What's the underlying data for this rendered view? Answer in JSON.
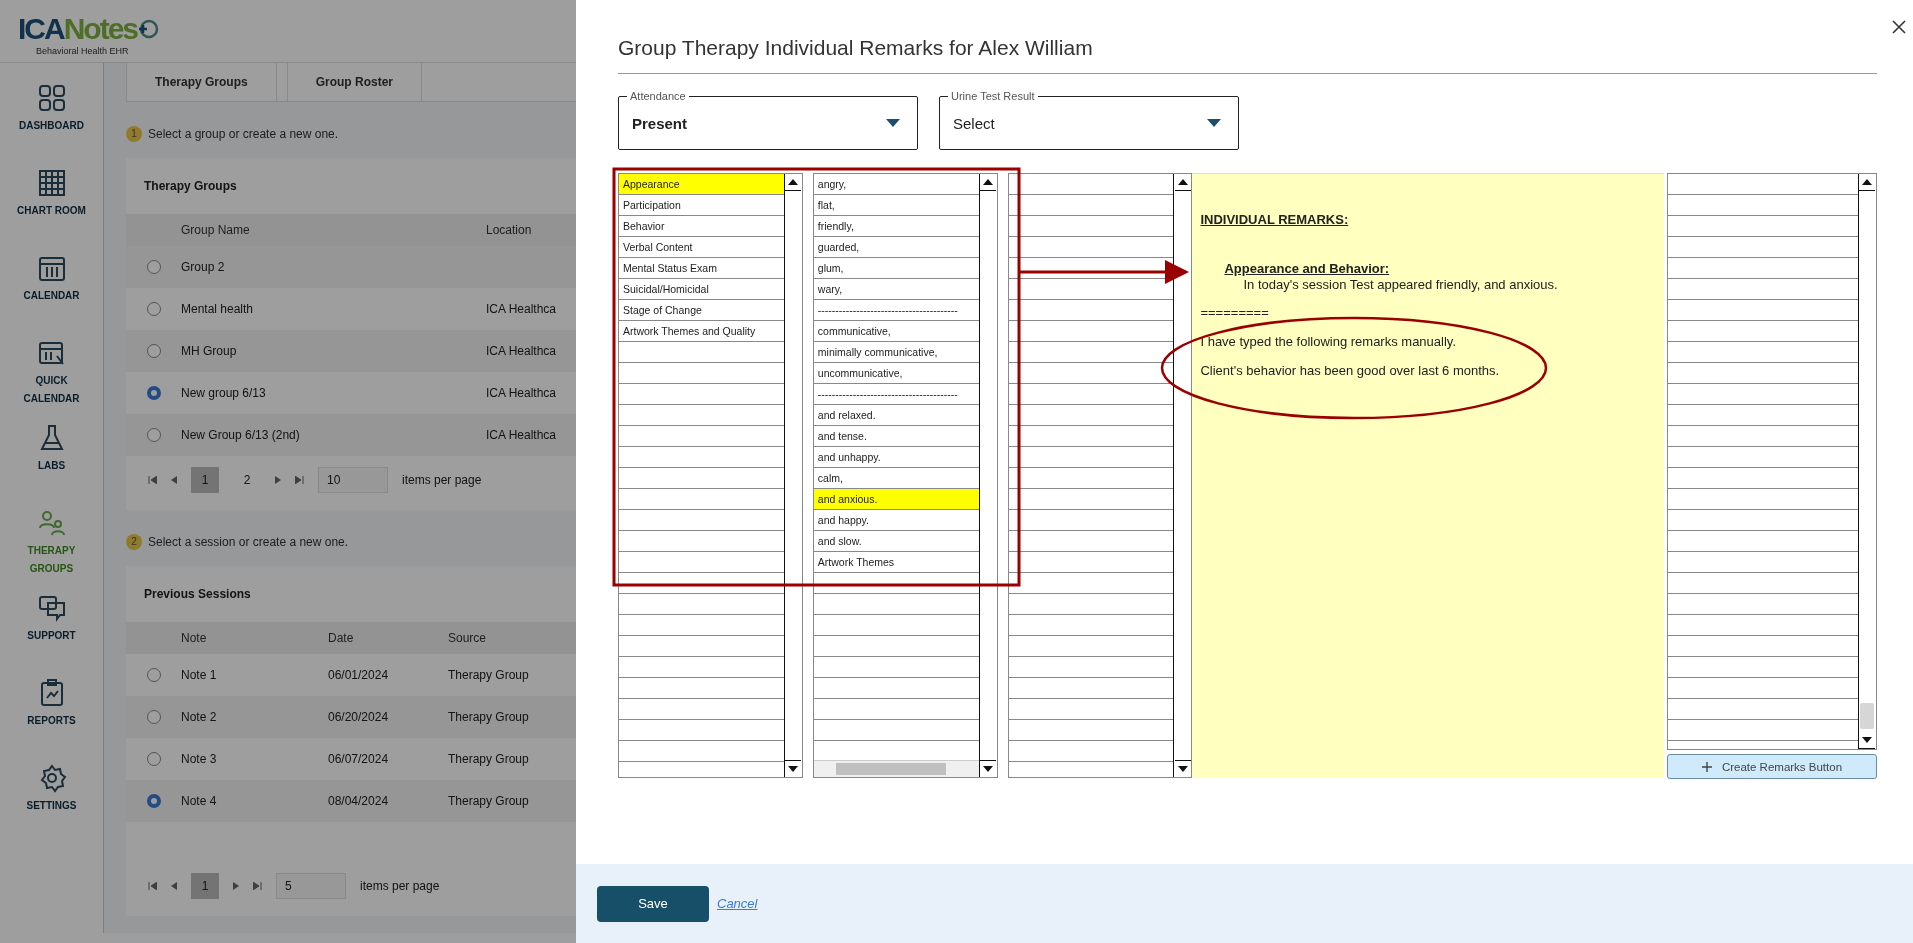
{
  "app": {
    "logo": {
      "prefix": "ICA",
      "suffix": "Notes",
      "tagline": "Behavioral Health EHR"
    },
    "nav": [
      {
        "label": "DASHBOARD",
        "selected": false
      },
      {
        "label": "CHART ROOM",
        "selected": false
      },
      {
        "label": "CALENDAR",
        "selected": false
      },
      {
        "label": "QUICK CALENDAR",
        "selected": false
      },
      {
        "label": "LABS",
        "selected": false
      },
      {
        "label": "THERAPY GROUPS",
        "selected": true
      },
      {
        "label": "SUPPORT",
        "selected": false
      },
      {
        "label": "REPORTS",
        "selected": false
      },
      {
        "label": "SETTINGS",
        "selected": false
      }
    ],
    "tabs": [
      {
        "label": "Therapy Groups"
      },
      {
        "label": "Group Roster"
      }
    ],
    "step1": {
      "number": "1",
      "text": "Select a group or create a new one."
    },
    "groups": {
      "title": "Therapy Groups",
      "columns": [
        "Group Name",
        "Location"
      ],
      "rows": [
        {
          "name": "Group 2",
          "selected": false
        },
        {
          "name": "Mental health",
          "location": "ICA Healthca",
          "selected": false
        },
        {
          "name": "MH Group",
          "location": "ICA Healthca",
          "selected": false
        },
        {
          "name": "New group 6/13",
          "location": "ICA Healthca",
          "selected": true
        },
        {
          "name": "New Group 6/13 (2nd)",
          "location": "ICA Healthca",
          "selected": false
        }
      ],
      "pager": {
        "pages": [
          {
            "label": "1",
            "selected": true
          },
          {
            "label": "2",
            "selected": false
          }
        ],
        "per_page": "10",
        "per_page_label": "items per page"
      }
    },
    "step2": {
      "number": "2",
      "text": "Select a session or create a new one."
    },
    "sessions": {
      "title": "Previous Sessions",
      "columns": [
        "Note",
        "Date",
        "Source"
      ],
      "rows": [
        {
          "note": "Note 1",
          "date": "06/01/2024",
          "source": "Therapy Group",
          "selected": false
        },
        {
          "note": "Note 2",
          "date": "06/20/2024",
          "source": "Therapy Group",
          "selected": false
        },
        {
          "note": "Note 3",
          "date": "06/07/2024",
          "source": "Therapy Group",
          "selected": false
        },
        {
          "note": "Note 4",
          "date": "08/04/2024",
          "source": "Therapy Group",
          "selected": true
        }
      ],
      "pager": {
        "pages": [
          {
            "label": "1",
            "selected": true
          }
        ],
        "per_page": "5",
        "per_page_label": "items per page"
      }
    }
  },
  "dialog": {
    "title": "Group Therapy Individual Remarks for Alex William",
    "attendance": {
      "label": "Attendance",
      "value": "Present"
    },
    "urine_test": {
      "label": "Urine Test Result",
      "value": "Select"
    },
    "categories": [
      {
        "label": "Appearance",
        "selected": true
      },
      {
        "label": "Participation",
        "selected": false
      },
      {
        "label": "Behavior",
        "selected": false
      },
      {
        "label": "Verbal Content",
        "selected": false
      },
      {
        "label": "Mental Status Exam",
        "selected": false
      },
      {
        "label": "Suicidal/Homicidal",
        "selected": false
      },
      {
        "label": "Stage of Change",
        "selected": false
      },
      {
        "label": "Artwork Themes and Quality",
        "selected": false
      }
    ],
    "phrases": [
      {
        "label": "angry,",
        "selected": false
      },
      {
        "label": "flat,",
        "selected": false
      },
      {
        "label": "friendly,",
        "selected": false
      },
      {
        "label": "guarded,",
        "selected": false
      },
      {
        "label": "glum,",
        "selected": false
      },
      {
        "label": "wary,",
        "selected": false
      },
      {
        "label": "----------------------------------------",
        "selected": false
      },
      {
        "label": "communicative,",
        "selected": false
      },
      {
        "label": "minimally communicative,",
        "selected": false
      },
      {
        "label": "uncommunicative,",
        "selected": false
      },
      {
        "label": "----------------------------------------",
        "selected": false
      },
      {
        "label": "and relaxed.",
        "selected": false
      },
      {
        "label": "and tense.",
        "selected": false
      },
      {
        "label": "and unhappy.",
        "selected": false
      },
      {
        "label": "calm,",
        "selected": false
      },
      {
        "label": "and anxious.",
        "selected": true
      },
      {
        "label": "and happy.",
        "selected": false
      },
      {
        "label": "and slow.",
        "selected": false
      },
      {
        "label": "Artwork Themes",
        "selected": false
      }
    ],
    "remarks": {
      "heading": "INDIVIDUAL REMARKS:",
      "section_title": "Appearance and Behavior:",
      "section_text": "In today's session Test appeared friendly, and anxious.",
      "separator": "=========",
      "typed_lines": [
        "I have typed the following remarks manually.",
        "Client's behavior has been good over last 6 months."
      ]
    },
    "create_button": "Create Remarks Button",
    "save": "Save",
    "cancel": "Cancel"
  }
}
